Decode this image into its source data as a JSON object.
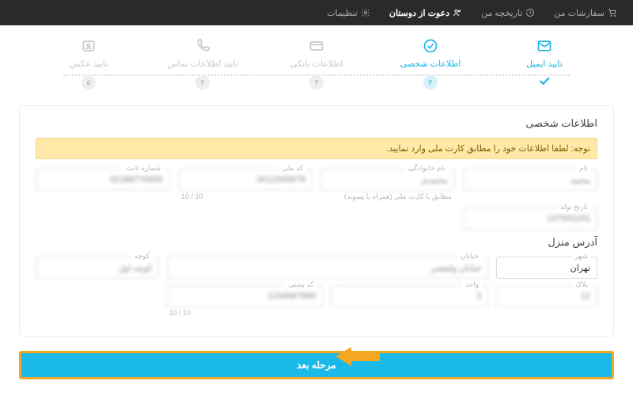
{
  "topbar": {
    "orders": "سفارشات من",
    "history": "تاریخچه من",
    "invite": "دعوت از دوستان",
    "settings": "تنظیمات"
  },
  "stepper": {
    "s1": {
      "label": "تایید ایمیل",
      "num": ""
    },
    "s2": {
      "label": "اطلاعات شخصی",
      "num": "۲"
    },
    "s3": {
      "label": "اطلاعات بانکی",
      "num": "۳"
    },
    "s4": {
      "label": "تایید اطلاعات تماس",
      "num": "۴"
    },
    "s5": {
      "label": "تایید عکس",
      "num": "۵"
    }
  },
  "section": {
    "title": "اطلاعات شخصی",
    "notice": "توجه: لطفا اطلاعات خود را مطابق کارت ملی وارد نمایید."
  },
  "fields": {
    "fname": {
      "label": "نام",
      "value": "محمد"
    },
    "lname": {
      "label": "نام خانوادگی",
      "value": "محمدی",
      "helper": "مطابق با کارت ملی (همراه با پسوند)"
    },
    "nid": {
      "label": "کد ملی",
      "value": "0012345678",
      "counter": "10 / 10"
    },
    "phone": {
      "label": "شماره ثابت",
      "value": "02188776655"
    },
    "dob": {
      "label": "تاریخ تولد",
      "value": "1370/01/01"
    },
    "address_title": "آدرس منزل",
    "city": {
      "label": "شهر",
      "value": "تهران"
    },
    "street": {
      "label": "خیابان",
      "value": "خیابان ولیعصر"
    },
    "alley": {
      "label": "کوچه",
      "value": "کوچه اول"
    },
    "plate": {
      "label": "پلاک",
      "value": "12"
    },
    "unit": {
      "label": "واحد",
      "value": "3"
    },
    "postal": {
      "label": "کد پستی",
      "value": "1234567890",
      "counter": "10 / 10"
    }
  },
  "next_button": "مرحله بعد"
}
